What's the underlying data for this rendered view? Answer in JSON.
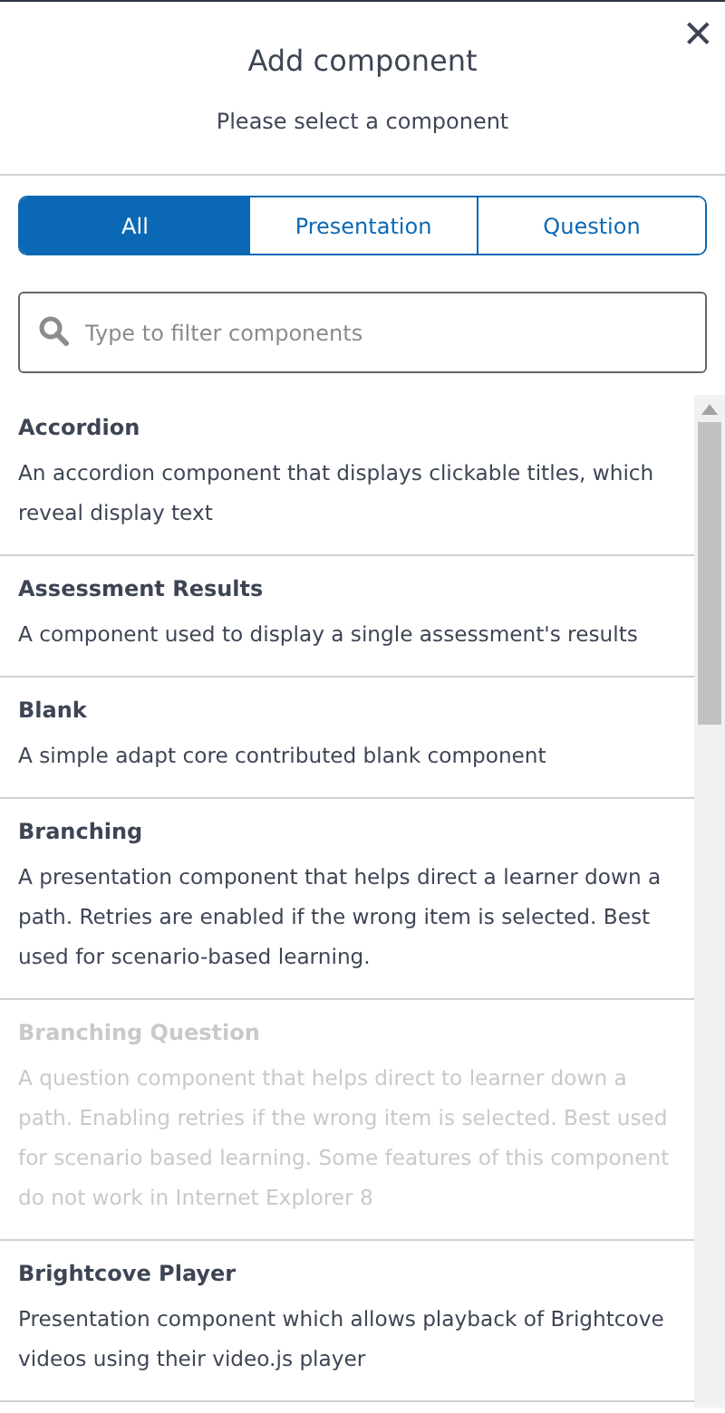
{
  "dialog": {
    "title": "Add component",
    "subtitle": "Please select a component",
    "close_label": "✕"
  },
  "tabs": [
    {
      "label": "All",
      "selected": true
    },
    {
      "label": "Presentation",
      "selected": false
    },
    {
      "label": "Question",
      "selected": false
    }
  ],
  "search": {
    "placeholder": "Type to filter components"
  },
  "components": [
    {
      "name": "Accordion",
      "description": "An accordion component that displays clickable titles, which reveal display text",
      "disabled": false
    },
    {
      "name": "Assessment Results",
      "description": "A component used to display a single assessment's results",
      "disabled": false
    },
    {
      "name": "Blank",
      "description": "A simple adapt core contributed blank component",
      "disabled": false
    },
    {
      "name": "Branching",
      "description": "A presentation component that helps direct a learner down a path. Retries are enabled if the wrong item is selected. Best used for scenario-based learning.",
      "disabled": false
    },
    {
      "name": "Branching Question",
      "description": "A question component that helps direct to learner down a path. Enabling retries if the wrong item is selected. Best used for scenario based learning. Some features of this component do not work in Internet Explorer 8",
      "disabled": true
    },
    {
      "name": "Brightcove Player",
      "description": "Presentation component which allows playback of Brightcove videos using their video.js player",
      "disabled": false
    }
  ]
}
